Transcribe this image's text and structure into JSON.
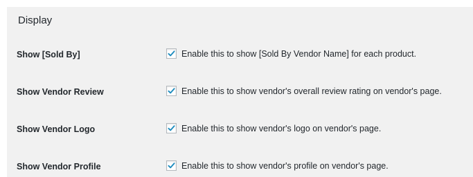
{
  "section": {
    "title": "Display"
  },
  "settings": [
    {
      "label": "Show [Sold By]",
      "checked": true,
      "description": "Enable this to show [Sold By Vendor Name] for each product."
    },
    {
      "label": "Show Vendor Review",
      "checked": true,
      "description": "Enable this to show vendor's overall review rating on vendor's page."
    },
    {
      "label": "Show Vendor Logo",
      "checked": true,
      "description": "Enable this to show vendor's logo on vendor's page."
    },
    {
      "label": "Show Vendor Profile",
      "checked": true,
      "description": "Enable this to show vendor's profile on vendor's page."
    }
  ],
  "colors": {
    "panel_background": "#f1f1f1",
    "checkmark": "#1e8cbe",
    "text": "#23282d"
  }
}
